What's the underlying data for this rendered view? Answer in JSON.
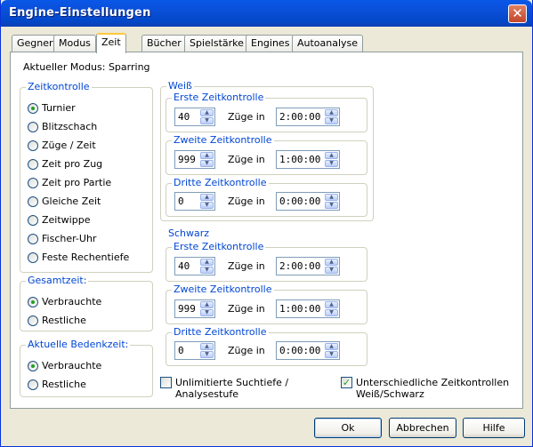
{
  "window": {
    "title": "Engine-Einstellungen"
  },
  "tabs": [
    "Gegner",
    "Modus",
    "Zeit",
    "Bücher",
    "Spielstärke",
    "Engines",
    "Autoanalyse"
  ],
  "current_mode": "Aktueller Modus: Sparring",
  "time_control": {
    "legend": "Zeitkontrolle",
    "options": [
      "Turnier",
      "Blitzschach",
      "Züge / Zeit",
      "Zeit pro Zug",
      "Zeit pro Partie",
      "Gleiche Zeit",
      "Zeitwippe",
      "Fischer-Uhr",
      "Feste Rechentiefe"
    ],
    "selected": "Turnier"
  },
  "total_time": {
    "legend": "Gesamtzeit:",
    "options": [
      "Verbrauchte",
      "Restliche"
    ],
    "selected": "Verbrauchte"
  },
  "thinking_time": {
    "legend": "Aktuelle Bedenkzeit:",
    "options": [
      "Verbrauchte",
      "Restliche"
    ],
    "selected": "Verbrauchte"
  },
  "white": {
    "legend": "Weiß",
    "controls": [
      {
        "legend": "Erste Zeitkontrolle",
        "moves": "40",
        "moves_label": "Züge in",
        "time": "2:00:00"
      },
      {
        "legend": "Zweite Zeitkontrolle",
        "moves": "999",
        "moves_label": "Züge in",
        "time": "1:00:00"
      },
      {
        "legend": "Dritte Zeitkontrolle",
        "moves": "0",
        "moves_label": "Züge in",
        "time": "0:00:00"
      }
    ]
  },
  "black": {
    "legend": "Schwarz",
    "controls": [
      {
        "legend": "Erste Zeitkontrolle",
        "moves": "40",
        "moves_label": "Züge in",
        "time": "2:00:00"
      },
      {
        "legend": "Zweite Zeitkontrolle",
        "moves": "999",
        "moves_label": "Züge in",
        "time": "1:00:00"
      },
      {
        "legend": "Dritte Zeitkontrolle",
        "moves": "0",
        "moves_label": "Züge in",
        "time": "0:00:00"
      }
    ]
  },
  "checkboxes": {
    "unlimited": {
      "line1": "Unlimitierte Suchtiefe /",
      "line2": "Analysestufe",
      "checked": false
    },
    "different": {
      "line1": "Unterschiedliche Zeitkontrollen",
      "line2": "Weiß/Schwarz",
      "checked": true
    }
  },
  "buttons": {
    "ok": "Ok",
    "cancel": "Abbrechen",
    "help": "Hilfe"
  },
  "icons": {
    "close": "close-icon",
    "spin_up": "arrow-up-icon",
    "spin_down": "arrow-down-icon",
    "check": "checkmark-icon"
  }
}
